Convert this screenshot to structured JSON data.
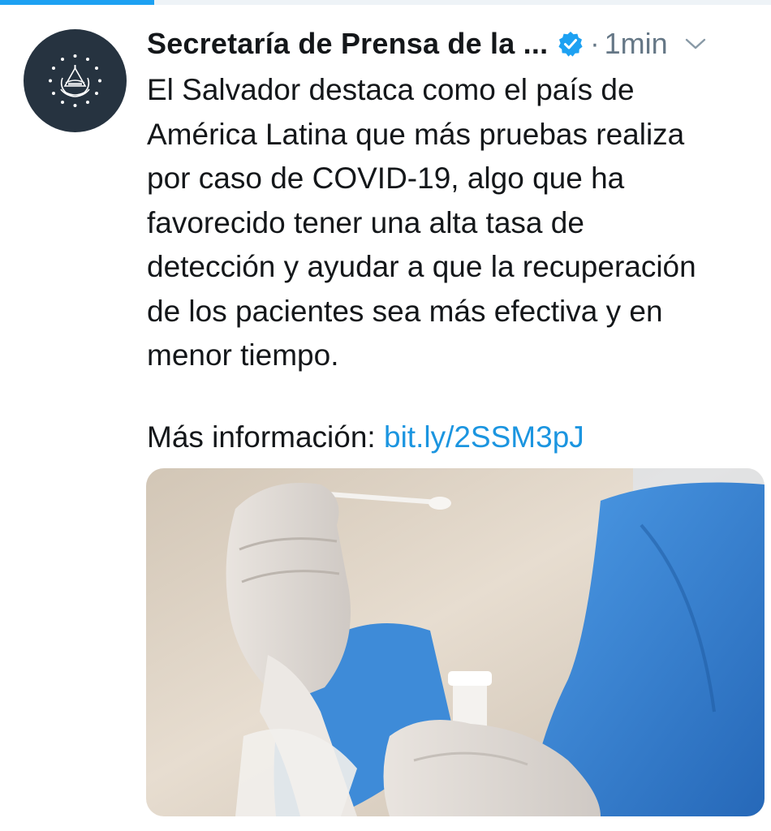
{
  "progress": {
    "fraction": 0.2
  },
  "tweet": {
    "display_name": "Secretaría de Prensa de la ...",
    "verified": true,
    "separator": "·",
    "timestamp": "1min",
    "text_lines": [
      "El Salvador destaca como el país de",
      "América Latina que más pruebas realiza",
      "por caso de COVID-19, algo que ha",
      "favorecido tener una alta tasa de",
      "detección y ayudar a que la recuperación",
      "de los pacientes sea más efectiva y en",
      "menor tiempo."
    ],
    "more_info_label": "Más información:",
    "link_text": "bit.ly/2SSM3pJ"
  },
  "icons": {
    "avatar": "coat-of-arms-icon",
    "verified": "verified-badge-icon",
    "menu": "chevron-down-icon"
  },
  "colors": {
    "accent": "#1da1f2",
    "link": "#1b95e0",
    "text": "#14171a",
    "muted": "#657786",
    "avatar_bg": "#263340",
    "gown": "#2f7fd0"
  }
}
